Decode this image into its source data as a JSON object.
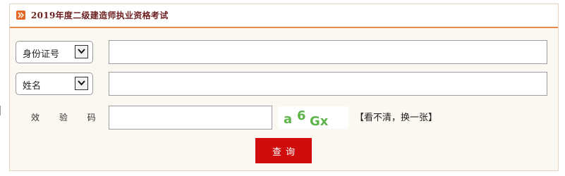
{
  "header": {
    "title": "2019年度二级建造师执业资格考试",
    "icon": "arrow-right-icon",
    "accent_color": "#e06a24",
    "title_color": "#6c1f1f"
  },
  "form": {
    "id_type_select": {
      "selected": "身份证号",
      "icon": "chevron-down-icon"
    },
    "id_value": "",
    "name_type_select": {
      "selected": "姓名",
      "icon": "chevron-down-icon"
    },
    "name_value": "",
    "captcha": {
      "label": "效 验 码",
      "value": "",
      "image_text": [
        "a",
        "6",
        "Gx"
      ],
      "refresh_text": "【看不清，换一张】"
    },
    "submit_label": "查询",
    "submit_color": "#d10c0c"
  }
}
